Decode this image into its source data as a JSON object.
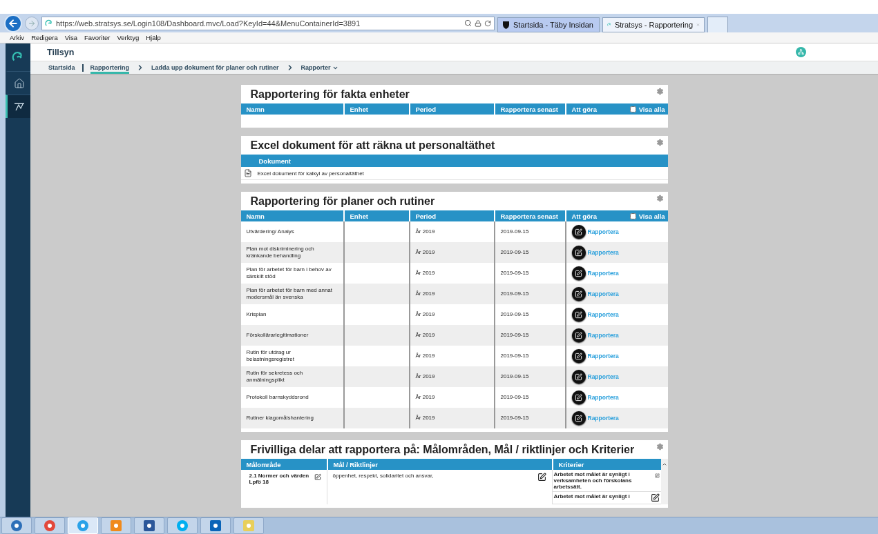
{
  "browser": {
    "url": "https://web.stratsys.se/Login108/Dashboard.mvc/Load?KeyId=44&MenuContainerId=3891",
    "tabs": [
      {
        "title": "Startsida - Täby Insidan",
        "kind": "shield",
        "selected": false
      },
      {
        "title": "Stratsys - Rapportering",
        "kind": "app",
        "selected": true
      }
    ],
    "menu": [
      "Arkiv",
      "Redigera",
      "Visa",
      "Favoriter",
      "Verktyg",
      "Hjälp"
    ]
  },
  "sidebar": {
    "items": [
      {
        "kind": "home",
        "selected": false
      },
      {
        "kind": "report",
        "selected": true
      }
    ]
  },
  "header": {
    "title": "Tillsyn"
  },
  "breadcrumb": [
    {
      "label": "Startsida",
      "selected": false,
      "kind": "link"
    },
    {
      "label": "Rapportering",
      "selected": true,
      "kind": "link"
    },
    {
      "label": "Ladda upp dokument för planer och rutiner",
      "selected": false,
      "kind": "link"
    },
    {
      "label": "Rapporter",
      "selected": false,
      "kind": "dropdown"
    }
  ],
  "cards": [
    {
      "kind": "report_table",
      "title": "Rapportering för fakta enheter",
      "columns": [
        "Namn",
        "Enhet",
        "Period",
        "Rapportera senast",
        "Att göra"
      ],
      "show_all": {
        "label": "Visa alla",
        "checked": false
      }
    },
    {
      "kind": "documents",
      "title": "Excel dokument för att räkna ut personaltäthet",
      "columns": [
        "Dokument"
      ],
      "documents": [
        "Excel dokument för kalkyl av personaltäthet"
      ]
    },
    {
      "kind": "report_table",
      "title": "Rapportering för planer och rutiner",
      "columns": [
        "Namn",
        "Enhet",
        "Period",
        "Rapportera senast",
        "Att göra"
      ],
      "show_all": {
        "label": "Visa alla",
        "checked": false
      },
      "rows": [
        {
          "name": "Utvärdering/ Analys",
          "period": "År 2019",
          "deadline": "2019-09-15",
          "action": "Rapportera"
        },
        {
          "name": "Plan mot diskriminering och kränkande behandling",
          "period": "År 2019",
          "deadline": "2019-09-15",
          "action": "Rapportera"
        },
        {
          "name": "Plan för arbetet för barn i behov av särskilt stöd",
          "period": "År 2019",
          "deadline": "2019-09-15",
          "action": "Rapportera"
        },
        {
          "name": "Plan för arbetet för barn med annat modersmål än svenska",
          "period": "År 2019",
          "deadline": "2019-09-15",
          "action": "Rapportera"
        },
        {
          "name": "Krisplan",
          "period": "År 2019",
          "deadline": "2019-09-15",
          "action": "Rapportera"
        },
        {
          "name": "Förskollärarlegitimationer",
          "period": "År 2019",
          "deadline": "2019-09-15",
          "action": "Rapportera"
        },
        {
          "name": "Rutin för utdrag ur belastningsregistret",
          "period": "År 2019",
          "deadline": "2019-09-15",
          "action": "Rapportera"
        },
        {
          "name": "Rutin för sekretess och anmälningsplikt",
          "period": "År 2019",
          "deadline": "2019-09-15",
          "action": "Rapportera"
        },
        {
          "name": "Protokoll barnskyddsrond",
          "period": "År 2019",
          "deadline": "2019-09-15",
          "action": "Rapportera"
        },
        {
          "name": "Rutiner klagomålshantering",
          "period": "År 2019",
          "deadline": "2019-09-15",
          "action": "Rapportera"
        }
      ]
    },
    {
      "kind": "criteria",
      "title": "Frivilliga delar att rapportera på: Målområden, Mål / riktlinjer och Kriterier",
      "columns": [
        "Målområde",
        "Mål / Riktlinjer",
        "Kriterier"
      ],
      "rows": [
        {
          "area": "2.1 Normer och värden Lpfö 18",
          "goal": "öppenhet, respekt, solidaritet och ansvar,",
          "criteria": [
            "Arbetet mot målet är synligt i verksamheten och förskolans arbetssätt.",
            "Arbetet mot målet är synligt i"
          ]
        }
      ]
    }
  ],
  "taskbar": [
    {
      "kind": "start",
      "selected": false
    },
    {
      "kind": "chrome",
      "selected": false
    },
    {
      "kind": "ie",
      "selected": true
    },
    {
      "kind": "media",
      "selected": false
    },
    {
      "kind": "word",
      "selected": false
    },
    {
      "kind": "skype",
      "selected": false
    },
    {
      "kind": "outlook",
      "selected": false
    },
    {
      "kind": "files",
      "selected": false
    }
  ]
}
